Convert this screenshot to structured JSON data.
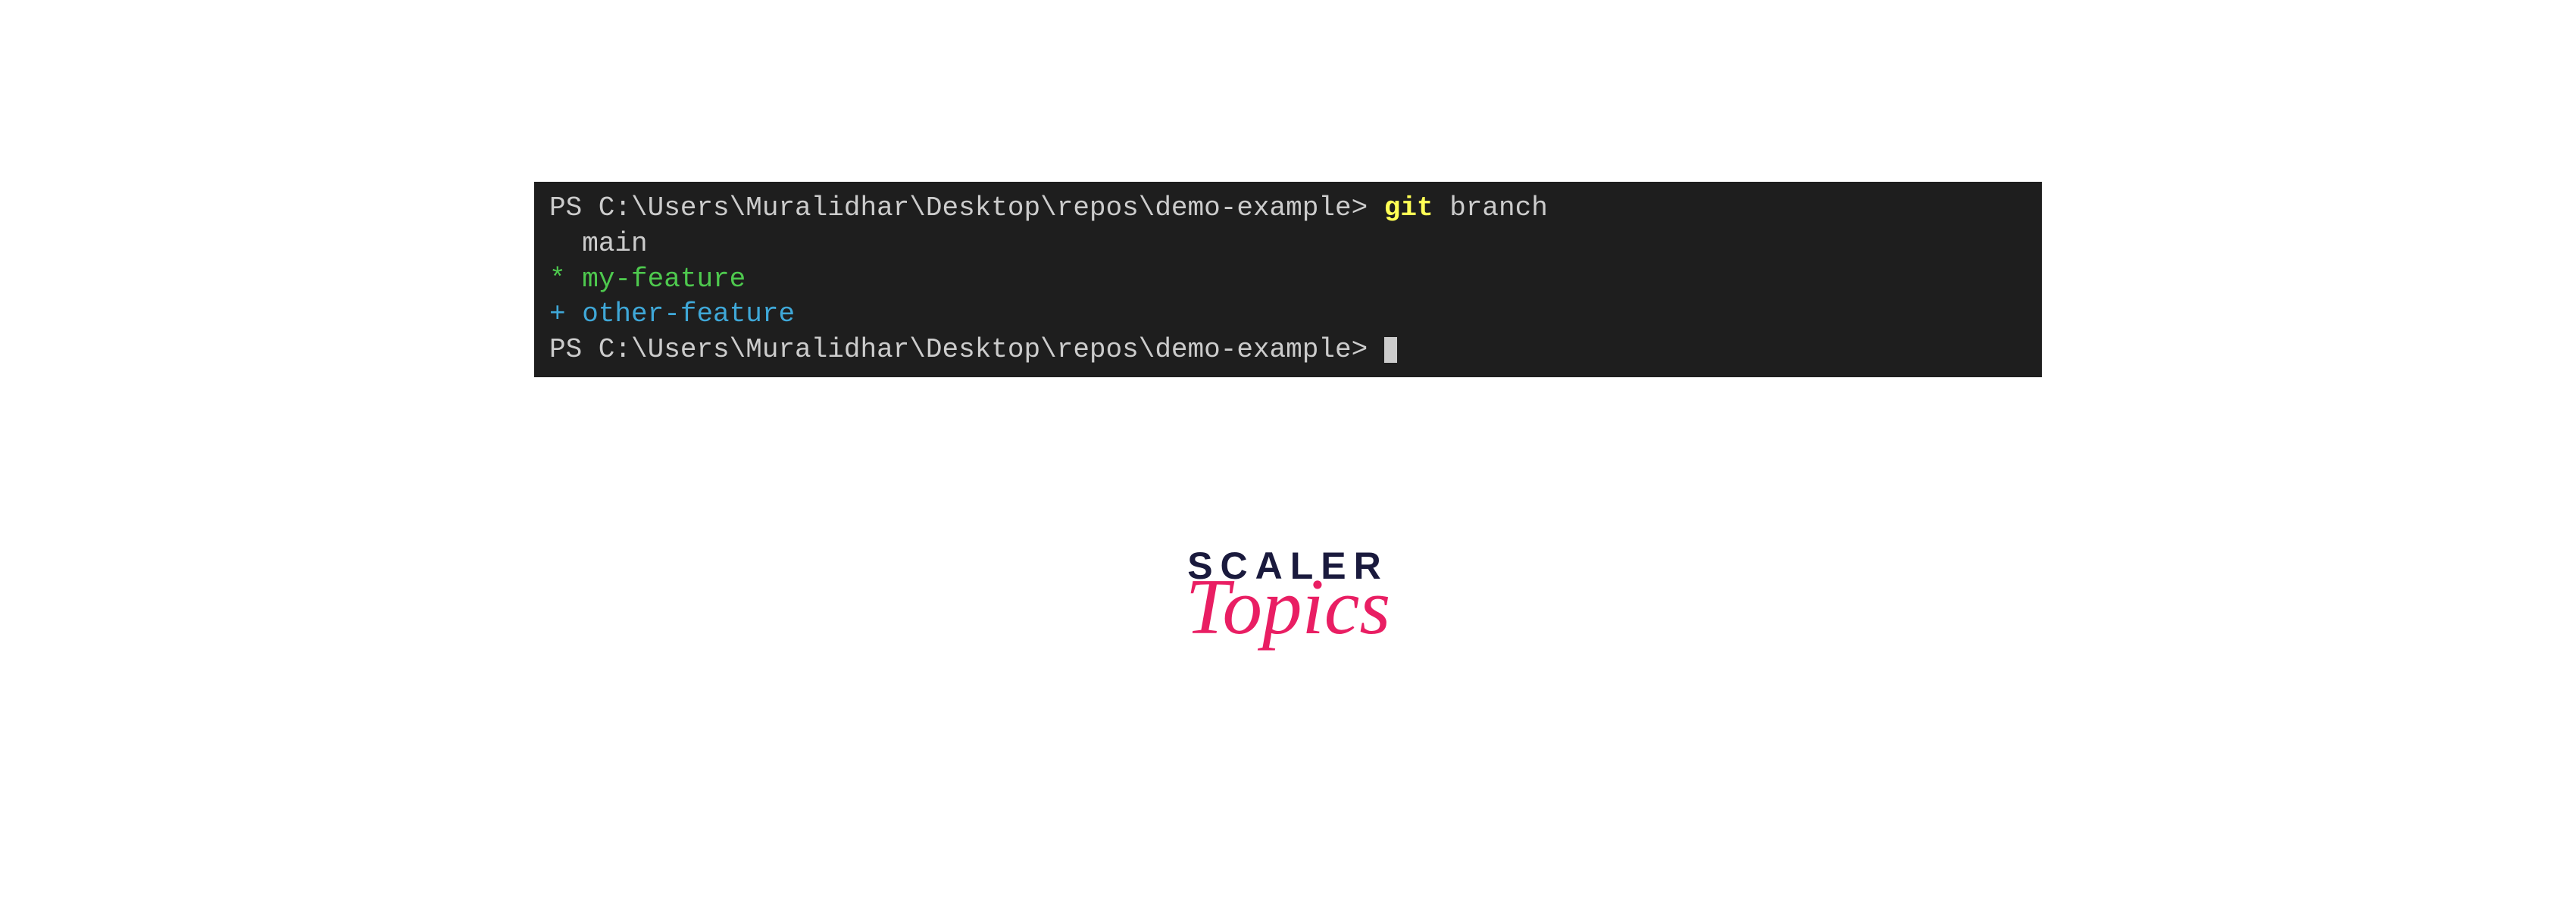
{
  "terminal": {
    "prompt1": "PS C:\\Users\\Muralidhar\\Desktop\\repos\\demo-example> ",
    "git_keyword": "git",
    "branch_arg": " branch",
    "branch_main_prefix": "  ",
    "branch_main": "main",
    "branch_current_prefix": "* ",
    "branch_current": "my-feature",
    "branch_other_prefix": "+ ",
    "branch_other": "other-feature",
    "prompt2": "PS C:\\Users\\Muralidhar\\Desktop\\repos\\demo-example> "
  },
  "logo": {
    "top": "SCALER",
    "bottom": "Topics"
  }
}
